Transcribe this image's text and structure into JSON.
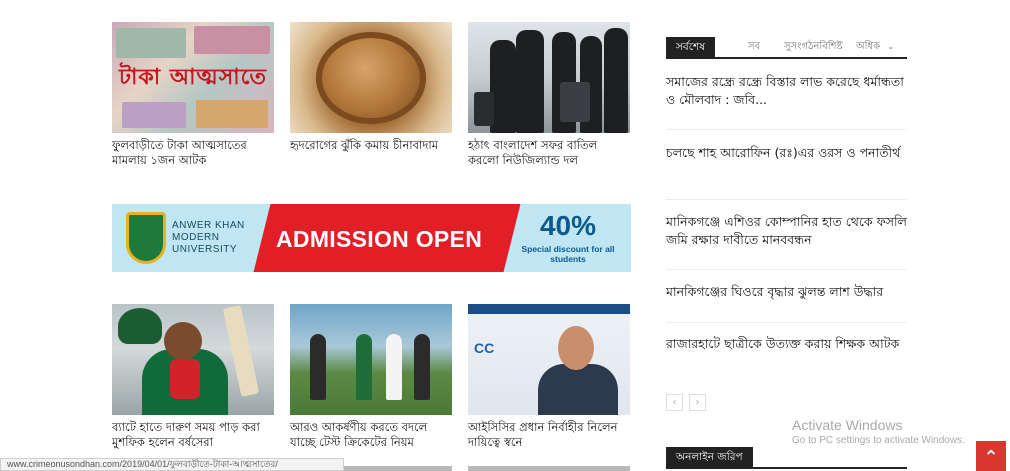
{
  "articles_top": [
    {
      "title": "ফুলবাড়ীতে টাকা আত্মসাতের মামলায় ১জন আটক",
      "image_text": "টাকা আত্মসাতে"
    },
    {
      "title": "হৃদরোগের ঝুঁকি কমায় চীনাবাদাম"
    },
    {
      "title": "হঠাৎ বাংলাদেশ সফর বাতিল করলো নিউজিল্যান্ড দল"
    }
  ],
  "banner": {
    "university_lines": [
      "ANWER KHAN",
      "MODERN",
      "UNIVERSITY"
    ],
    "headline": "ADMISSION OPEN",
    "discount": "40%",
    "discount_note": "Special discount for all students",
    "colors": {
      "bg": "#bfe6f2",
      "red": "#e21e26",
      "blue": "#0d5a8c"
    }
  },
  "articles_bottom": [
    {
      "title": "ব্যাটে হাতে দারুণ সময় পাড় করা মুশফিক হলেন বর্ষসেরা"
    },
    {
      "title": "আরও আকর্ষণীয় করতে বদলে যাচ্ছে টেস্ট ক্রিকেটের নিয়ম"
    },
    {
      "title": "আইসিসির প্রধান নির্বাহীর নিলেন দায়িত্বে স্বনে",
      "image_text": "CC"
    }
  ],
  "sidebar": {
    "tabs": {
      "active": "সর্বশেষ",
      "items": [
        "সব",
        "সুসংগঠনবিশিষ্ট",
        "অধিক"
      ]
    },
    "latest": [
      "সমাজের রন্ধ্রে রন্ধ্রে বিস্তার লাভ করেছে ধর্মান্ধতা ও মৌলবাদ : জবি...",
      "চলছে শাহ আরোফিন (রঃ)এর ওরস ও পনাতীর্থ",
      "মানিকগঞ্জে এশিওর কোম্পানির হাত থেকে ফসলি জমি রক্ষার দাবীতে মানববন্ধন",
      "মানকিগঞ্জের ঘিওরে বৃদ্ধার ঝুলন্ত লাশ উদ্ধার",
      "রাজারহাটে ছাত্রীকে উত্যক্ত করায় শিক্ষক আটক"
    ],
    "pager": {
      "prev": "‹",
      "next": "›"
    },
    "section2_title": "অনলাইন জরিপ"
  },
  "watermark": {
    "line1": "Activate Windows",
    "line2": "Go to PC settings to activate Windows."
  },
  "back_to_top": "⌃",
  "status_url": "www.crimeonusondhan.com/2019/04/01/ফুলবাড়ীতে-টাকা-আত্মসাতের/",
  "colors": {
    "accent": "#d8362e",
    "dark": "#222222"
  }
}
